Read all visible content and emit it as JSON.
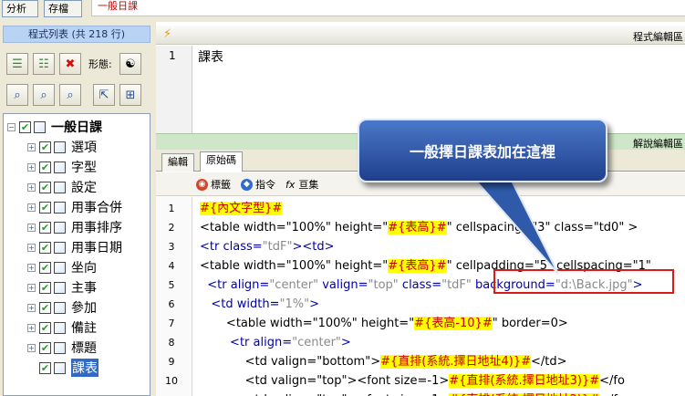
{
  "top": {
    "analyze_label": "分析",
    "save_label": "存檔",
    "input_value": "一般日課"
  },
  "left_panel": {
    "title": "程式列表 (共 218 行)",
    "form_label": "形態:",
    "tree": [
      {
        "label": "一般日課",
        "checked": true,
        "level": 0
      },
      {
        "label": "選項",
        "checked": true,
        "level": 1
      },
      {
        "label": "字型",
        "checked": true,
        "level": 1
      },
      {
        "label": "設定",
        "checked": true,
        "level": 1
      },
      {
        "label": "用事合併",
        "checked": true,
        "level": 1
      },
      {
        "label": "用事排序",
        "checked": true,
        "level": 1
      },
      {
        "label": "用事日期",
        "checked": true,
        "level": 1
      },
      {
        "label": "坐向",
        "checked": true,
        "level": 1
      },
      {
        "label": "主事",
        "checked": true,
        "level": 1
      },
      {
        "label": "參加",
        "checked": true,
        "level": 1
      },
      {
        "label": "備註",
        "checked": true,
        "level": 1
      },
      {
        "label": "標題",
        "checked": true,
        "level": 1
      },
      {
        "label": "課表",
        "checked": true,
        "level": 1,
        "selected": true
      }
    ]
  },
  "editor": {
    "header_title": "程式編輯區",
    "line1_number": "1",
    "line1_text": "課表",
    "explain_title": "解說編輯區",
    "tabs": [
      "編輯",
      "原始碼"
    ],
    "subtools": [
      "標籤",
      "指令",
      "亘集"
    ],
    "code_lines": [
      {
        "n": "1",
        "parts": [
          {
            "c": "hl",
            "t": "#{內文字型}#"
          }
        ]
      },
      {
        "n": "2",
        "parts": [
          {
            "c": "",
            "t": "<table width=\"100%\" height=\""
          },
          {
            "c": "hl",
            "t": "#{表高}#"
          },
          {
            "c": "",
            "t": "\" cellspacing=\"3\" class=\"td0\" >"
          }
        ]
      },
      {
        "n": "3",
        "parts": [
          {
            "c": "tag",
            "t": "<tr "
          },
          {
            "c": "tag",
            "t": "class="
          },
          {
            "c": "str",
            "t": "\"tdF\""
          },
          {
            "c": "tag",
            "t": "><td>"
          }
        ]
      },
      {
        "n": "4",
        "parts": [
          {
            "c": "",
            "t": "<table width=\"100%\" height=\""
          },
          {
            "c": "hl",
            "t": "#{表高}#"
          },
          {
            "c": "",
            "t": "\" cellpadding=\"5\" cellspacing=\"1\""
          }
        ]
      },
      {
        "n": "5",
        "parts": [
          {
            "c": "tag",
            "t": "  <tr "
          },
          {
            "c": "tag",
            "t": "align="
          },
          {
            "c": "str",
            "t": "\"center\" "
          },
          {
            "c": "tag",
            "t": "valign="
          },
          {
            "c": "str",
            "t": "\"top\" "
          },
          {
            "c": "tag",
            "t": "class="
          },
          {
            "c": "str",
            "t": "\"tdF\" "
          },
          {
            "c": "tag",
            "t": "background="
          },
          {
            "c": "str",
            "t": "\"d:\\Back.jpg\""
          },
          {
            "c": "tag",
            "t": ">"
          }
        ]
      },
      {
        "n": "6",
        "parts": [
          {
            "c": "tag",
            "t": "   <td "
          },
          {
            "c": "tag",
            "t": "width="
          },
          {
            "c": "str",
            "t": "\"1%\""
          },
          {
            "c": "tag",
            "t": ">"
          }
        ]
      },
      {
        "n": "7",
        "parts": [
          {
            "c": "",
            "t": "       <table width=\"100%\" height=\""
          },
          {
            "c": "hl",
            "t": "#{表高-10}#"
          },
          {
            "c": "",
            "t": "\" border=0>"
          }
        ]
      },
      {
        "n": "8",
        "parts": [
          {
            "c": "tag",
            "t": "        <tr "
          },
          {
            "c": "tag",
            "t": "align="
          },
          {
            "c": "str",
            "t": "\"center\""
          },
          {
            "c": "tag",
            "t": ">"
          }
        ]
      },
      {
        "n": "9",
        "parts": [
          {
            "c": "",
            "t": "            <td valign=\"bottom\">"
          },
          {
            "c": "hl",
            "t": "#{直排(系統.擇日地址4)}#"
          },
          {
            "c": "",
            "t": "</td>"
          }
        ]
      },
      {
        "n": "10",
        "parts": [
          {
            "c": "",
            "t": "            <td valign=\"top\"><font size=-1>"
          },
          {
            "c": "hl",
            "t": "#{直排(系統.擇日地址3)}#"
          },
          {
            "c": "",
            "t": "</fo"
          }
        ]
      },
      {
        "n": "11",
        "parts": [
          {
            "c": "",
            "t": "            <td valign=\"top\"><font size=-1>"
          },
          {
            "c": "hl",
            "t": "#{直排(系統.擇日地址2)}#"
          },
          {
            "c": "",
            "t": "</fo"
          }
        ]
      }
    ]
  },
  "callout": {
    "text": "一般擇日課表加在這裡"
  },
  "colors": {
    "highlight": "#ffff00",
    "highlight_text": "#cc0000",
    "callout": "#2f5aaa",
    "annotation_box": "#e01818"
  }
}
